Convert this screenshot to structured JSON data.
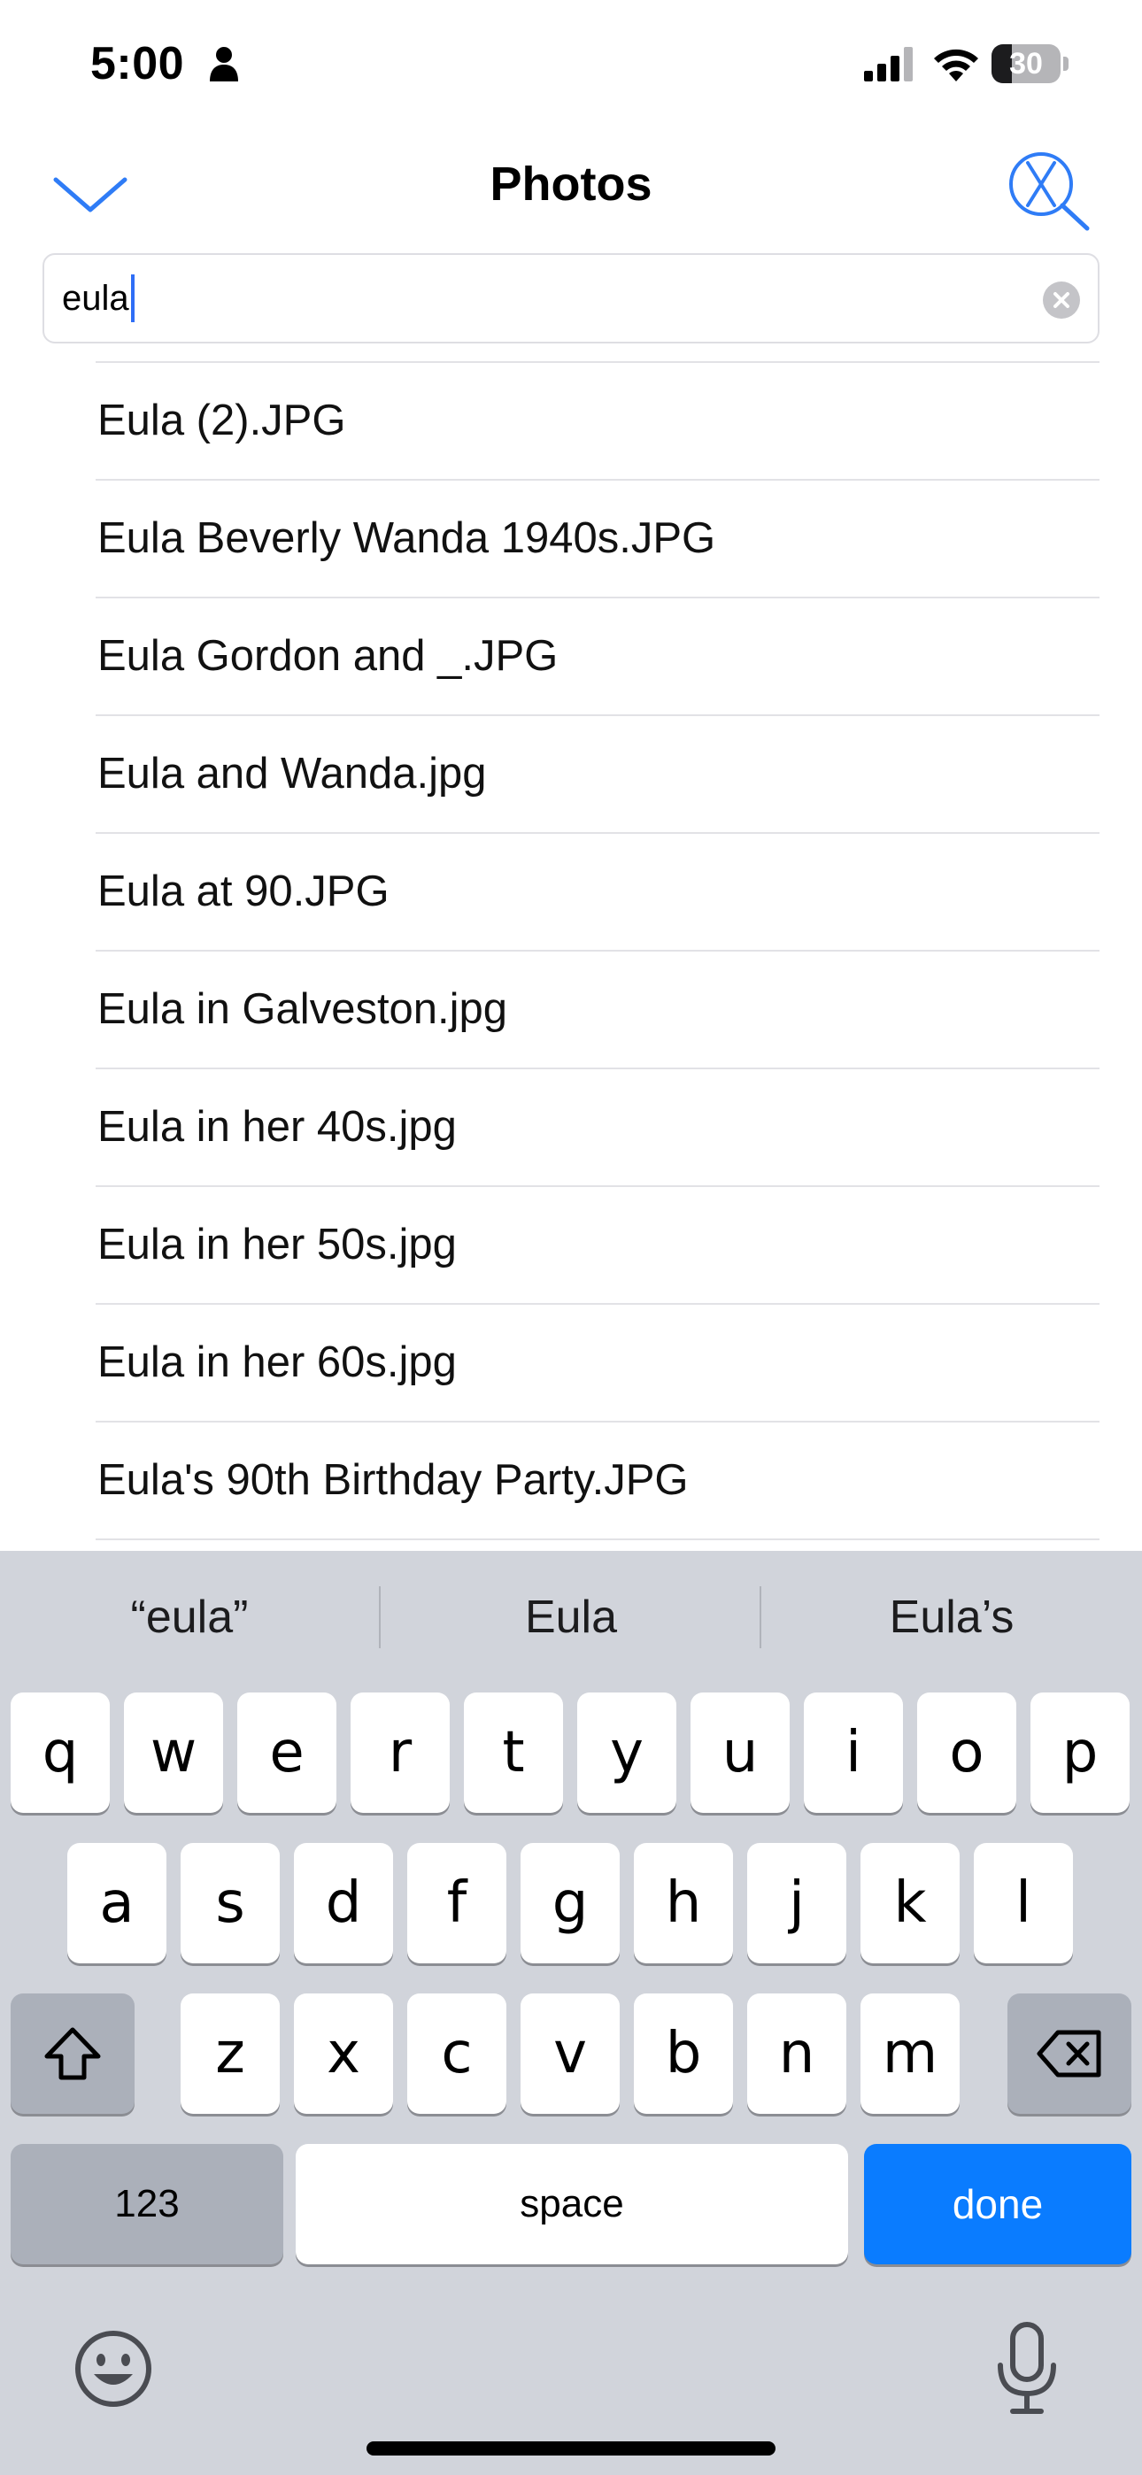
{
  "status_bar": {
    "time": "5:00",
    "battery_level": "30",
    "battery_fraction": 0.3
  },
  "nav": {
    "title": "Photos",
    "accent_color": "#2f7cf6"
  },
  "search": {
    "value": "eula"
  },
  "results": [
    "Eula (2).JPG",
    "Eula Beverly Wanda 1940s.JPG",
    "Eula Gordon and _.JPG",
    "Eula and Wanda.jpg",
    "Eula at 90.JPG",
    "Eula in Galveston.jpg",
    "Eula in her 40s.jpg",
    "Eula in her 50s.jpg",
    "Eula in her 60s.jpg",
    "Eula's 90th Birthday Party.JPG"
  ],
  "keyboard": {
    "suggestions": [
      "“eula”",
      "Eula",
      "Eula’s"
    ],
    "row1": [
      "q",
      "w",
      "e",
      "r",
      "t",
      "y",
      "u",
      "i",
      "o",
      "p"
    ],
    "row2": [
      "a",
      "s",
      "d",
      "f",
      "g",
      "h",
      "j",
      "k",
      "l"
    ],
    "row3": [
      "z",
      "x",
      "c",
      "v",
      "b",
      "n",
      "m"
    ],
    "numbers_label": "123",
    "space_label": "space",
    "done_label": "done",
    "done_color": "#0a7cff"
  }
}
